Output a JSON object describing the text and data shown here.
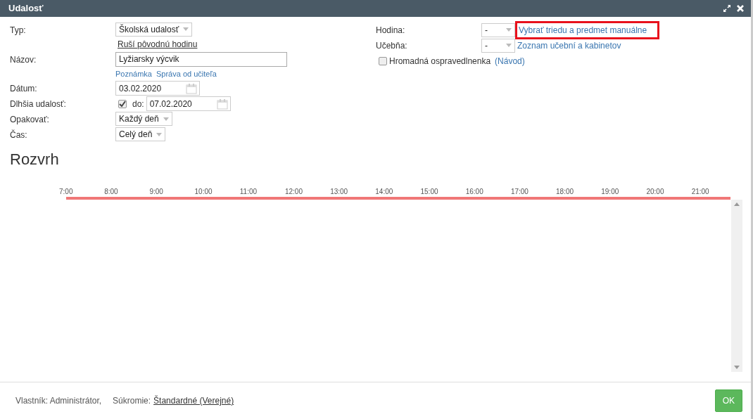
{
  "window": {
    "title": "Udalosť"
  },
  "left_fields": [
    {
      "label": "Typ:",
      "kind": "select",
      "value": "Školská udalosť",
      "links": [
        {
          "text": "Ruší pôvodnú hodinu",
          "kind": "underlined"
        }
      ]
    },
    {
      "label": "Názov:",
      "kind": "text",
      "value": "Lyžiarsky výcvik",
      "links": [
        {
          "text": "Poznámka",
          "kind": "plain"
        },
        {
          "text": "Správa od učiteľa",
          "kind": "plain"
        }
      ]
    },
    {
      "label": "Dátum:",
      "kind": "date",
      "value": "03.02.2020"
    },
    {
      "label": "Dlhšia udalosť:",
      "kind": "range",
      "checked": true,
      "prefix": "do:",
      "value": "07.02.2020"
    },
    {
      "label": "Opakovať:",
      "kind": "select",
      "value": "Každý deň"
    },
    {
      "label": "Čas:",
      "kind": "select",
      "value": "Celý deň"
    }
  ],
  "right_fields": [
    {
      "label": "Hodina:",
      "value": "-",
      "link": {
        "text": "Vybrať triedu a predmet manuálne",
        "highlighted": true
      }
    },
    {
      "label": "Učebňa:",
      "value": "-",
      "link": {
        "text": "Zoznam učební a kabinetov",
        "highlighted": false
      }
    }
  ],
  "bulk_excuse": {
    "label": "Hromadná ospravedlnenka",
    "checked": false,
    "help": "(Návod)"
  },
  "schedule": {
    "title": "Rozvrh",
    "hours": [
      "7:00",
      "8:00",
      "9:00",
      "10:00",
      "11:00",
      "12:00",
      "13:00",
      "14:00",
      "15:00",
      "16:00",
      "17:00",
      "18:00",
      "19:00",
      "20:00",
      "21:00"
    ]
  },
  "footer": {
    "owner": "Vlastník: Administrátor,",
    "privacy_label": "Súkromie:",
    "privacy_value": "Štandardné (Verejné)",
    "ok": "OK"
  }
}
